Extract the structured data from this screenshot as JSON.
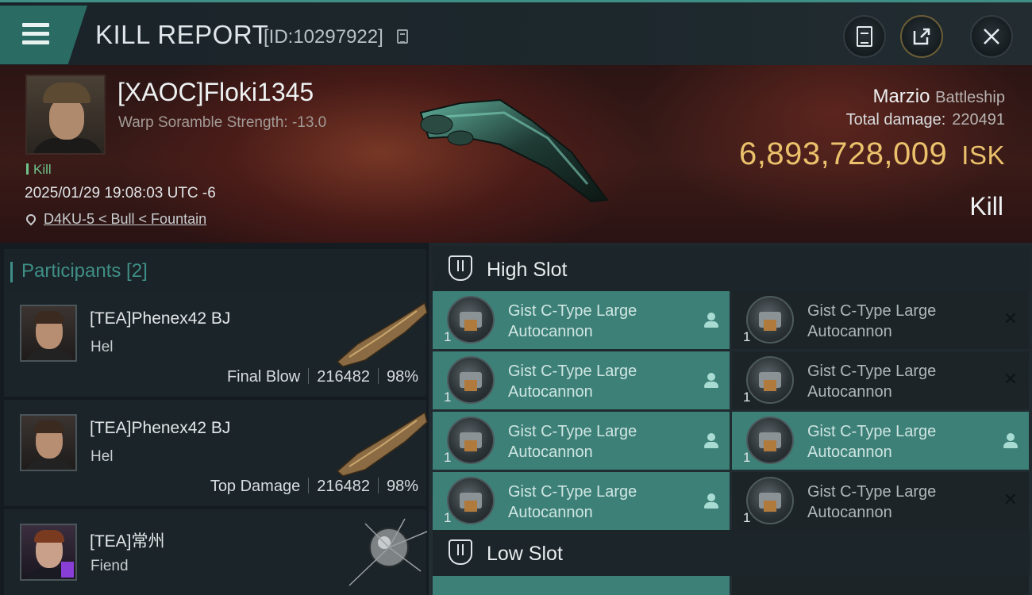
{
  "header": {
    "title": "KILL REPORT",
    "id_text": "[ID:10297922]"
  },
  "victim": {
    "name": "[XAOC]Floki1345",
    "warp_text": "Warp Soramble Strength: -13.0",
    "kill_tag": "Kill",
    "datetime": "2025/01/29 19:08:03 UTC -6",
    "location": "D4KU-5 < Bull < Fountain",
    "ship_name": "Marzio",
    "ship_class": "Battleship",
    "damage_label": "Total damage:",
    "damage_value": "220491",
    "isk_value": "6,893,728,009",
    "isk_unit": "ISK",
    "result": "Kill"
  },
  "participants": {
    "heading": "Participants [2]",
    "rows": [
      {
        "name": "[TEA]Phenex42 BJ",
        "ship": "Hel",
        "label": "Final Blow",
        "damage": "216482",
        "percent": "98%"
      },
      {
        "name": "[TEA]Phenex42 BJ",
        "ship": "Hel",
        "label": "Top Damage",
        "damage": "216482",
        "percent": "98%"
      },
      {
        "name": "[TEA]常州",
        "ship": "Fiend",
        "label": "",
        "damage": "",
        "percent": ""
      }
    ]
  },
  "slots": {
    "high_label": "High Slot",
    "low_label": "Low Slot",
    "high": [
      {
        "line1": "Gist C-Type Large",
        "line2": "Autocannon",
        "qty": "1",
        "state": "fitted"
      },
      {
        "line1": "Gist C-Type Large",
        "line2": "Autocannon",
        "qty": "1",
        "state": "destroyed"
      },
      {
        "line1": "Gist C-Type Large",
        "line2": "Autocannon",
        "qty": "1",
        "state": "fitted"
      },
      {
        "line1": "Gist C-Type Large",
        "line2": "Autocannon",
        "qty": "1",
        "state": "destroyed"
      },
      {
        "line1": "Gist C-Type Large",
        "line2": "Autocannon",
        "qty": "1",
        "state": "fitted"
      },
      {
        "line1": "Gist C-Type Large",
        "line2": "Autocannon",
        "qty": "1",
        "state": "fitted"
      },
      {
        "line1": "Gist C-Type Large",
        "line2": "Autocannon",
        "qty": "1",
        "state": "fitted"
      },
      {
        "line1": "Gist C-Type Large",
        "line2": "Autocannon",
        "qty": "1",
        "state": "destroyed"
      }
    ]
  },
  "colors": {
    "accent": "#3f8f86",
    "isk": "#ebc16c",
    "fitted_slot": "#3d8078"
  }
}
